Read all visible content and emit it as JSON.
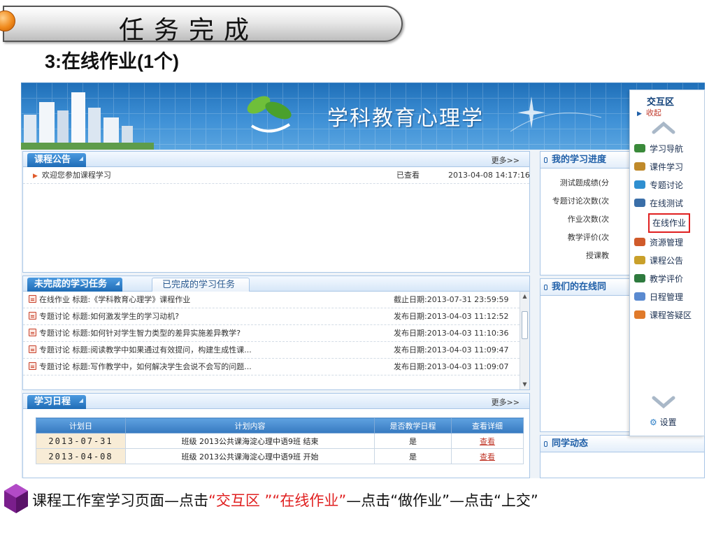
{
  "slide": {
    "banner_title": "任务完成",
    "subtitle_num": "3:",
    "subtitle_text": "在线作业",
    "subtitle_paren": "(1个)"
  },
  "site": {
    "title": "学科教育心理学"
  },
  "announcement": {
    "tab_label": "课程公告",
    "more_label": "更多>>",
    "items": [
      {
        "title": "欢迎您参加课程学习",
        "status": "已查看",
        "datetime": "2013-04-08 14:17:16"
      }
    ]
  },
  "tasks": {
    "tab_active": "未完成的学习任务",
    "tab_inactive": "已完成的学习任务",
    "items": [
      {
        "type": "在线作业",
        "title": "标题:《学科教育心理学》课程作业",
        "date": "截止日期:2013-07-31 23:59:59"
      },
      {
        "type": "专题讨论",
        "title": "标题:如何激发学生的学习动机?",
        "date": "发布日期:2013-04-03 11:12:52"
      },
      {
        "type": "专题讨论",
        "title": "标题:如何针对学生智力类型的差异实施差异教学?",
        "date": "发布日期:2013-04-03 11:10:36"
      },
      {
        "type": "专题讨论",
        "title": "标题:阅读教学中如果通过有效提问，构建生成性课...",
        "date": "发布日期:2013-04-03 11:09:47"
      },
      {
        "type": "专题讨论",
        "title": "标题:写作教学中，如何解决学生会说不会写的问题...",
        "date": "发布日期:2013-04-03 11:09:07"
      }
    ]
  },
  "schedule": {
    "tab_label": "学习日程",
    "more_label": "更多>>",
    "columns": [
      "计划日",
      "计划内容",
      "是否教学日程",
      "查看详细"
    ],
    "rows": [
      {
        "date": "2013-07-31",
        "content": "班级 2013公共课海淀心理中语9班 结束",
        "is_teaching": "是",
        "link": "查看"
      },
      {
        "date": "2013-04-08",
        "content": "班级 2013公共课海淀心理中语9班 开始",
        "is_teaching": "是",
        "link": "查看"
      }
    ]
  },
  "progress": {
    "head": "我的学习进度",
    "stats": [
      "测试题成绩(分",
      "专题讨论次数(次",
      "作业次数(次",
      "教学评价(次",
      "授课教"
    ]
  },
  "online": {
    "head": "我们的在线同"
  },
  "classmates": {
    "head": "同学动态"
  },
  "drawer": {
    "title": "交互区",
    "collapse_label": "收起",
    "items": [
      {
        "label": "学习导航",
        "icon": "compass-icon",
        "color": "#3a8a3a"
      },
      {
        "label": "课件学习",
        "icon": "book-icon",
        "color": "#c08a2a"
      },
      {
        "label": "专题讨论",
        "icon": "discussion-icon",
        "color": "#2f8fd0"
      },
      {
        "label": "在线测试",
        "icon": "test-icon",
        "color": "#3a6ea8"
      },
      {
        "label": "在线作业",
        "icon": "homework-icon",
        "color": "#7aa0c4"
      },
      {
        "label": "资源管理",
        "icon": "resource-icon",
        "color": "#d05a2a"
      },
      {
        "label": "课程公告",
        "icon": "notice-icon",
        "color": "#c9a02a"
      },
      {
        "label": "教学评价",
        "icon": "evaluation-icon",
        "color": "#2e7a3e"
      },
      {
        "label": "日程管理",
        "icon": "calendar-icon",
        "color": "#5a8ad0"
      },
      {
        "label": "课程答疑区",
        "icon": "qa-icon",
        "color": "#e07a2a"
      }
    ],
    "settings_label": "设置"
  },
  "caption": {
    "part1": "课程工作室学习页面—点击",
    "part2": "“交互区 ”“在线作业”",
    "part3": "—点击“做作业”—点击“上交”"
  },
  "colors": {
    "accent_red": "#e02020",
    "header_blue": "#2f80c8"
  }
}
